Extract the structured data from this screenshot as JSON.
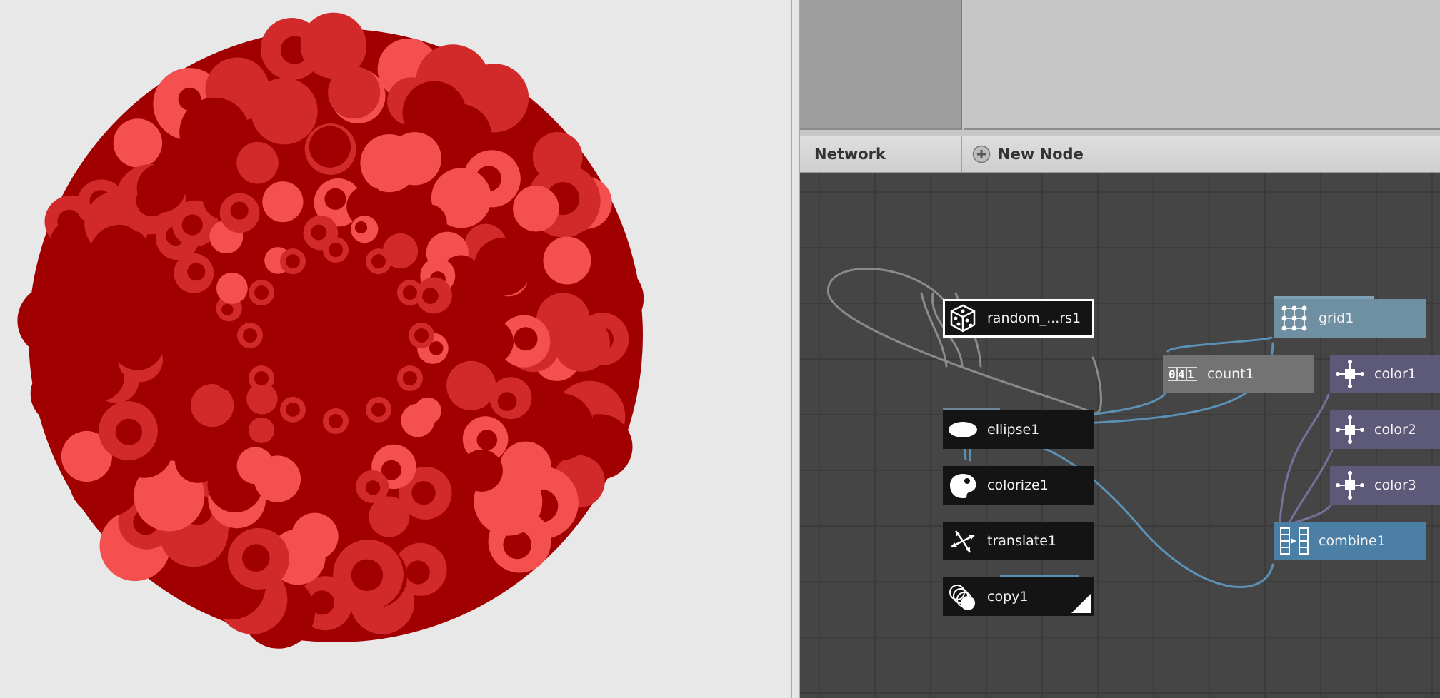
{
  "viewer": {
    "colors": {
      "background": "#e8e8e8",
      "dark": "#a10000",
      "mid": "#d22a2a",
      "light": "#f45050"
    }
  },
  "tabbar": {
    "network_label": "Network",
    "new_node_label": "New Node",
    "new_node_icon": "plus-circle-icon"
  },
  "network": {
    "nodes": {
      "random": {
        "label": "random_...rs1",
        "icon": "dice-icon"
      },
      "grid": {
        "label": "grid1",
        "icon": "grid-icon"
      },
      "count": {
        "label": "count1",
        "icon": "counter-icon"
      },
      "color1": {
        "label": "color1",
        "icon": "color-icon"
      },
      "color2": {
        "label": "color2",
        "icon": "color-icon"
      },
      "color3": {
        "label": "color3",
        "icon": "color-icon"
      },
      "ellipse": {
        "label": "ellipse1",
        "icon": "ellipse-icon"
      },
      "colorize": {
        "label": "colorize1",
        "icon": "palette-icon"
      },
      "translate": {
        "label": "translate1",
        "icon": "move-arrows-icon"
      },
      "copy": {
        "label": "copy1",
        "icon": "stack-copies-icon"
      },
      "combine": {
        "label": "combine1",
        "icon": "list-combine-icon"
      }
    },
    "colors": {
      "canvas": "#454545",
      "wire_blue": "#5b91b5",
      "wire_grey": "#8a8a8a"
    }
  }
}
